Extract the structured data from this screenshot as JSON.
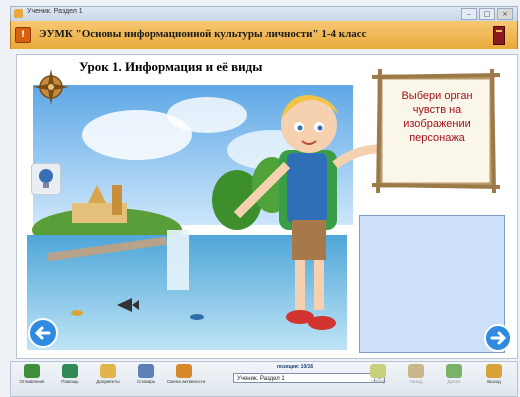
{
  "window": {
    "title": "Ученик. Раздел 1",
    "controls": [
      "–",
      "□",
      "×"
    ]
  },
  "header": {
    "title": "ЭУМК \"Основы информационной культуры личности\" 1-4 класс",
    "logo_icon": "app-logo-icon",
    "book_icon": "book-icon"
  },
  "lesson": {
    "title": "Урок 1. Информация и её виды",
    "task": "Выбери орган чувств на изображении персонажа"
  },
  "toolbar": {
    "buttons": [
      {
        "label": "Оглавление",
        "icon": "contents-icon",
        "color": "#3f8f3a"
      },
      {
        "label": "Помощь",
        "icon": "help-icon",
        "color": "#2f8a55"
      },
      {
        "label": "Документы",
        "icon": "documents-icon",
        "color": "#e0b64a"
      },
      {
        "label": "Словарь",
        "icon": "dictionary-icon",
        "color": "#5b7fb7"
      },
      {
        "label": "Смена активности",
        "icon": "activity-icon",
        "color": "#d68a2b"
      }
    ],
    "position_label": "позиция: 10/16",
    "lesson_select": "Ученик. Раздел 1",
    "right_buttons": [
      {
        "label": "Повтор",
        "icon": "repeat-icon",
        "color": "#c9cf7a",
        "disabled": true
      },
      {
        "label": "Назад",
        "icon": "back-icon",
        "color": "#c9b98a",
        "disabled": true
      },
      {
        "label": "Далее",
        "icon": "next-icon",
        "color": "#7bb26a",
        "disabled": true
      },
      {
        "label": "Выход",
        "icon": "exit-icon",
        "color": "#d8a23a",
        "disabled": false
      }
    ]
  }
}
